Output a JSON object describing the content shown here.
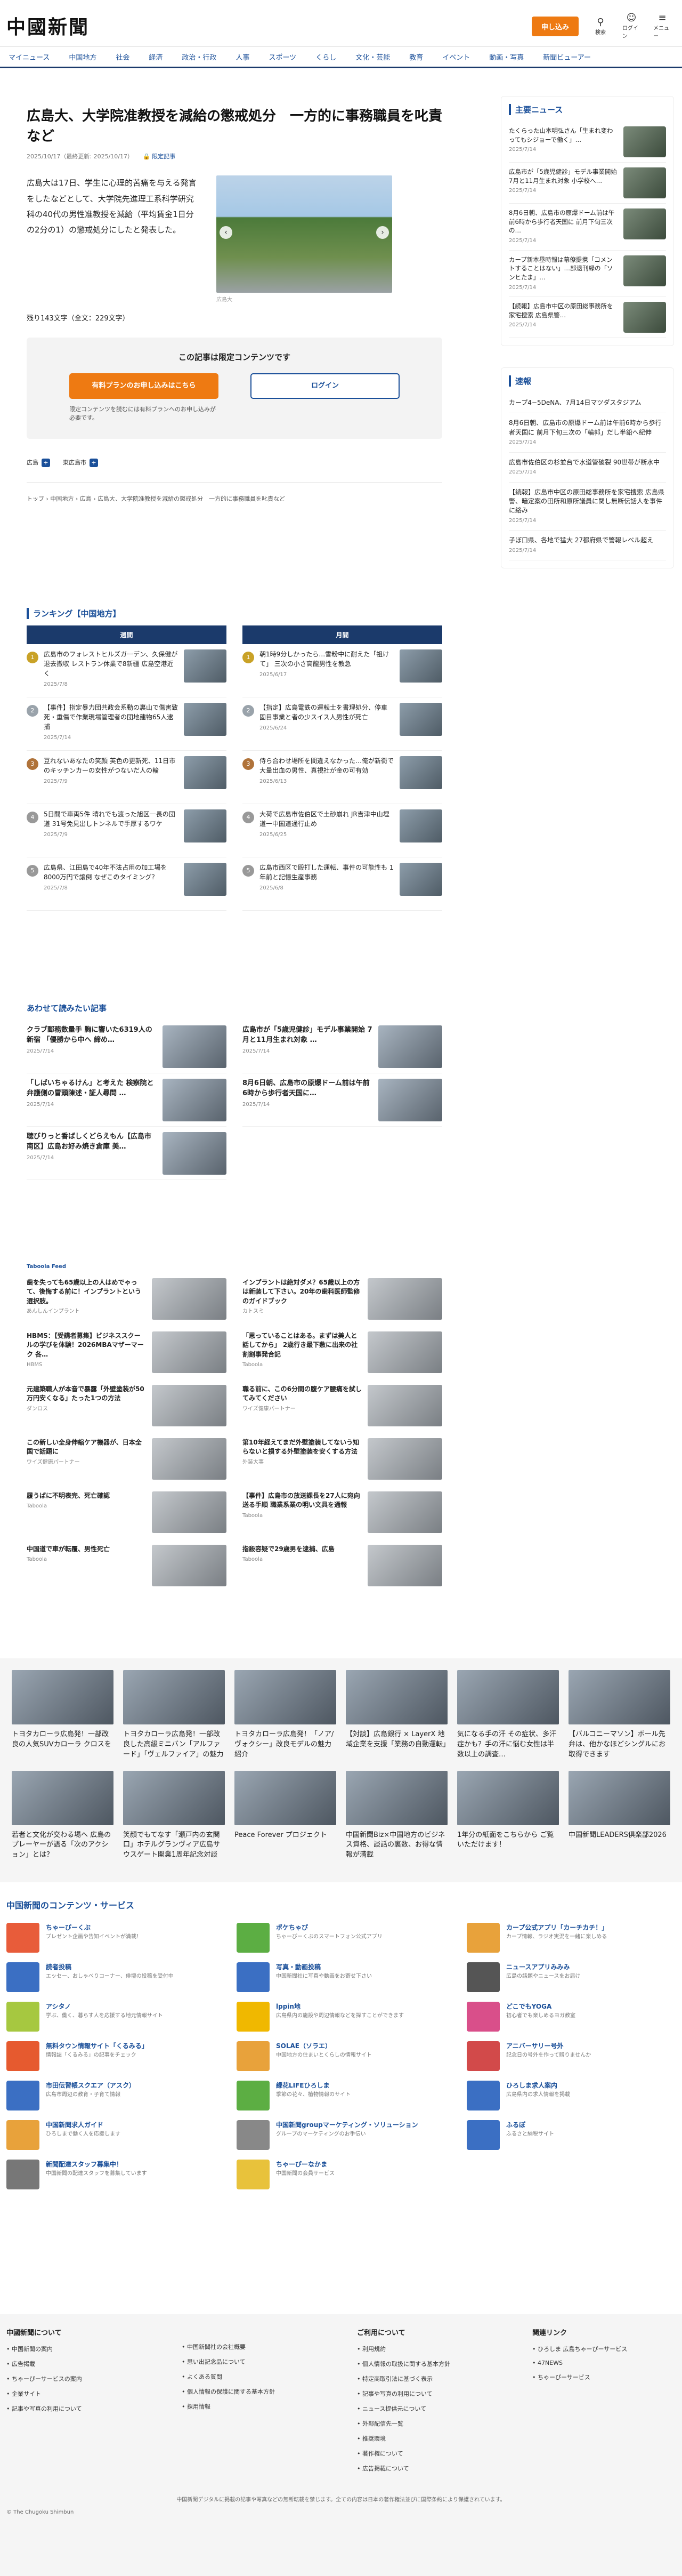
{
  "header": {
    "logo": "中國新聞",
    "apply": "申し込み",
    "search": "検索",
    "login": "ログイン",
    "menu": "メニュー"
  },
  "nav": [
    "マイニュース",
    "中国地方",
    "社会",
    "経済",
    "政治・行政",
    "人事",
    "スポーツ",
    "くらし",
    "文化・芸能",
    "教育",
    "イベント",
    "動画・写真",
    "新聞ビューアー"
  ],
  "article": {
    "title": "広島大、大学院准教授を減給の懲戒処分　一方的に事務職員を叱責など",
    "date": "2025/10/17（最終更新: 2025/10/17）",
    "limited": "限定記事",
    "lead": "広島大は17日、学生に心理的苦痛を与える発言をしたなどとして、大学院先進理工系科学研究科の40代の男性准教授を減給（平均賃金1日分の2分の1）の懲戒処分にしたと発表した。",
    "caption": "広島大",
    "counts": "残り143文字（全文：229文字）",
    "paywall_title": "この記事は限定コンテンツです",
    "paid_btn": "有料プランのお申し込みはこちら",
    "login_btn": "ログイン",
    "pw_note": "限定コンテンツを読むには有料プランへのお申し込みが必要です。",
    "tags": [
      "広島",
      "東広島市"
    ],
    "breadcrumb": "トップ › 中国地方 › 広島 › 広島大、大学院准教授を減給の懲戒処分　一方的に事務職員を叱責など"
  },
  "sidebar": {
    "main_title": "主要ニュース",
    "main": [
      {
        "t": "たくらった山本明弘さん「生まれ変わってもシジョーで働く」…",
        "d": "2025/7/14"
      },
      {
        "t": "広島市が「5歳児健診」モデル事業開始 7月と11月生まれ対象 小学校へ…",
        "d": "2025/7/14"
      },
      {
        "t": "8月6日朝、広島市の原爆ドーム前は午前6時から歩行者天国に 前月下旬三次の…",
        "d": "2025/7/14"
      },
      {
        "t": "カープ新本塁時報は幕僚提携「コメントすることはない」…部退刊緑の「ソンヒたま」…",
        "d": "2025/7/14"
      },
      {
        "t": "【続報】広島市中区の原田総事務所を家宅捜索 広島県警…",
        "d": "2025/7/14"
      }
    ],
    "flash_title": "速報",
    "flash": [
      {
        "t": "カープ4−5DeNA、7月14日マツダスタジアム",
        "d": ""
      },
      {
        "t": "8月6日朝、広島市の原爆ドーム前は午前6時から歩行者天国に 前月下旬三次の「輪郭」だし半鉛へ紀伸",
        "d": "2025/7/14"
      },
      {
        "t": "広島市佐伯区の杉並台で水道管破裂 90世帯が断水中",
        "d": "2025/7/14"
      },
      {
        "t": "【続報】広島市中区の原田総事務所を家宅捜索 広島県警、暗定案の田所和原所議員に関し無断伝話人を事件に絡み",
        "d": "2025/7/14"
      },
      {
        "t": "子ぼ口県、各地で猛大 27都府県で警報レベル超え",
        "d": "2025/7/14"
      }
    ]
  },
  "ranking": {
    "title": "ランキング【中国地方】",
    "weekly": "週間",
    "monthly": "月間",
    "left": [
      {
        "t": "広島市のフォレストヒルズガーデン、久保健が退去撤収 レストラン休業で8新疆 広島空港近く",
        "d": "2025/7/8"
      },
      {
        "t": "【事件】指定暴力団共政会系動の裏山で傷害致死・重傷で作業現場管理者の団地建物65人逮捕",
        "d": "2025/7/14"
      },
      {
        "t": "豆れないあなたの笑顔 英色の更新死、11日市のキッチンカーの女性がつないだ人の輪",
        "d": "2025/7/9"
      },
      {
        "t": "5日間で車両5件 晴れでも渡った旭区一長の団道 31号免見出しトンネルで手厚するワケ",
        "d": "2025/7/9"
      },
      {
        "t": "広島県、江田島で40年不法占用の加工場を8000万円で譲倒 なぜこのタイミング？",
        "d": "2025/7/8"
      }
    ],
    "right": [
      {
        "t": "朝1時9分しかったら…雪粉中に耐えた「祖けて」 三次の小さ高龍男性を教急",
        "d": "2025/6/17"
      },
      {
        "t": "【指定】広島電鉄の運転士を書理処分、停車 固目事業と者の少スイス人男性が死亡",
        "d": "2025/6/24"
      },
      {
        "t": "侍ら合わせ場所を間違えなかった…俺が新街で大量出血の男性、真視社が金の可有効",
        "d": "2025/6/13"
      },
      {
        "t": "大荷で広島市佐伯区で土砂崩れ JR吉津中山埋道一中国道通行止め",
        "d": "2025/6/25"
      },
      {
        "t": "広島市西区で殴打した運転、事件の可能性も 1年前と記憶生産事務",
        "d": "2025/6/8"
      }
    ]
  },
  "related": {
    "title": "あわせて読みたい記事",
    "items": [
      {
        "t": "クラブ郵務数量手 胸に響いた6319人の新宿 「優勝から中へ 締め…",
        "d": "2025/7/14"
      },
      {
        "t": "広島市が「5歳児健診」モデル事業開始 7月と11月生まれ対象 …",
        "d": "2025/7/14"
      },
      {
        "t": "「しばいちゃるけん」と考えた 検察院と弁護側の冒頭陳述・証人尋問 …",
        "d": "2025/7/14"
      },
      {
        "t": "8月6日朝、広島市の原爆ドーム前は午前6時から歩行者天国に…",
        "d": "2025/7/14"
      },
      {
        "t": "聴びりっと香ばしくどらえもん【広島市南区】広島お好み焼き倉庫 美…",
        "d": "2025/7/14"
      }
    ]
  },
  "ads": {
    "source": "Taboola Feed",
    "items": [
      {
        "t": "歯を失っても65歳以上の人はめでゃって、後悔する前に！インプラントという選択肢。",
        "d": "あんしんインプラント"
      },
      {
        "t": "インプラントは絶対ダメ？65歳以上の方は新装して下さい。20年の歯科医師監修のガイドブック",
        "d": "カトスミ"
      },
      {
        "t": "HBMS：【受講者募集】ビジネススクールの学びを体験！2026MBAマザーマーク 各…",
        "d": "HBMS"
      },
      {
        "t": "「思っていることはある。まずは美人と話してから」 2歳行き最下敷に出来の社割割事発合記",
        "d": "Taboola"
      },
      {
        "t": "元建築職人が本音で暴露「外壁塗装が50万円安くなる」たった1つの方法",
        "d": "ダンロス"
      },
      {
        "t": "職る前に、この6分間の腹ケア腰痛を試してみてください",
        "d": "ワイズ健康パートナー"
      },
      {
        "t": "この新しい全身伸縮ケア機器が、日本全国で話題に",
        "d": "ワイズ健康パートナー"
      },
      {
        "t": "第10年経えてまだ外壁塗装してないう知らないと損する外壁塗装を安くする方法",
        "d": "外装大事"
      },
      {
        "t": "履うばに不明表完、死亡確認",
        "d": "Taboola"
      },
      {
        "t": "【事件】広島市の放送課長を27人に宛向送る手順 職業系業の明い文具を通報",
        "d": "Taboola"
      },
      {
        "t": "中国道で車が転覆、男性死亡",
        "d": "Taboola"
      },
      {
        "t": "指殺容疑で29歳男を逮捕、広島",
        "d": "Taboola"
      }
    ]
  },
  "band": {
    "row1": [
      "トヨタカローラ広島発！一部改良の人気SUVカローラ クロスを",
      "トヨタカローラ広島発！一部改良した高級ミニバン「アルファード」「ヴェルファイア」の魅力",
      "トヨタカローラ広島発！「ノア/ヴォクシー」改良モデルの魅力紹介",
      "【対談】広島銀行 × LayerX 地域企業を支援「業務の自動運転」",
      "気になる手の汗 その症状、多汗症かも？手の汗に悩む女性は半数以上の調査…",
      "【バルコニーマソン】ボール先弁は、他かなほどシングルにお取得できます"
    ],
    "row2": [
      "若者と文化が交わる場へ 広島のプレーヤーが語る「次のアクション」とは？",
      "笑顔でもてなす「瀬戸内の玄関口」ホテルグランヴィア広島サウスゲート開業1周年記念対談",
      "Peace Forever プロジェクト",
      "中国新聞Biz×中国地方のビジネス資格、談話の裏数、お得な情報が満載",
      "1年分の紙面をこちらから ご覧いただけます！",
      "中国新聞LEADERS倶楽部2026"
    ]
  },
  "services": {
    "title": "中国新聞のコンテンツ・サービス",
    "items": [
      {
        "n": "ちゃーぴーくぶ",
        "ds": "プレゼント企画や告知イベントが満載！",
        "c": "#e85c3a"
      },
      {
        "n": "ポケちゃぴ",
        "ds": "ちゃーぴーくぶのスマートフォン公式アプリ",
        "c": "#5cae43"
      },
      {
        "n": "カープ公式アプリ「カーチカチ！」",
        "ds": "カープ情報、ラジオ実況を一緒に楽しめる",
        "c": "#e8a23b"
      },
      {
        "n": "読者投稿",
        "ds": "エッセー、おしゃべりコーナー、俳壇の投稿を受付中",
        "c": "#3b6fc3"
      },
      {
        "n": "写真・動画投稿",
        "ds": "中国新聞社に写真や動画をお寄せ下さい",
        "c": "#3b6fc3"
      },
      {
        "n": "ニュースアプリみみみ",
        "ds": "広島の話題やニュースをお届け",
        "c": "#555"
      },
      {
        "n": "アシタノ",
        "ds": "学ぶ、働く、暮らす人を応援する地元情報サイト",
        "c": "#a6c840"
      },
      {
        "n": "lppin地",
        "ds": "広島県内の施設や周辺情報などを探すことができます",
        "c": "#f0b800"
      },
      {
        "n": "どこでもYOGA",
        "ds": "初心者でも楽しめるヨガ教室",
        "c": "#d94f8a"
      },
      {
        "n": "無料タウン情報サイト「くるみる」",
        "ds": "情報誌「くるみる」の記事をチェック",
        "c": "#e65a2f"
      },
      {
        "n": "SOLAE（ソラエ）",
        "ds": "中国地方の住まいとくらしの情報サイト",
        "c": "#e8a23b"
      },
      {
        "n": "アニバーサリー号外",
        "ds": "記念日の号外を作って贈りませんか",
        "c": "#d24a4a"
      },
      {
        "n": "市田伝習帳スクエア（アスク）",
        "ds": "広島市周辺の教育・子育て情報",
        "c": "#3b6fc3"
      },
      {
        "n": "緑花LIFEひろしま",
        "ds": "季節の花々、植物情報のサイト",
        "c": "#5cae43"
      },
      {
        "n": "ひろしま求人案内",
        "ds": "広島県内の求人情報を掲載",
        "c": "#3b6fc3"
      },
      {
        "n": "中国新聞求人ガイド",
        "ds": "ひろしまで働く人を応援します",
        "c": "#e8a23b"
      },
      {
        "n": "中国新聞groupマーケティング・ソリューション",
        "ds": "グループのマーケティングのお手伝い",
        "c": "#888"
      },
      {
        "n": "ふるぽ",
        "ds": "ふるさと納税サイト",
        "c": "#3b6fc3"
      },
      {
        "n": "新聞配達スタッフ募集中！",
        "ds": "中国新聞の配達スタッフを募集しています",
        "c": "#777"
      },
      {
        "n": "ちゃーぴーなかま",
        "ds": "中国新聞の会員サービス",
        "c": "#e8c23b"
      }
    ]
  },
  "footer": {
    "about_title": "中國新聞について",
    "about": [
      "中国新聞の案内",
      "広告掲載",
      "ちゃーぴーサービスの案内",
      "企業サイト",
      "記事や写真の利用について"
    ],
    "about2": [
      "中国新聞社の会社概要",
      "思い出記念品について",
      "よくある質問",
      "個人情報の保護に関する基本方針",
      "採用情報"
    ],
    "use_title": "ご利用について",
    "use": [
      "利用規約",
      "個人情報の取扱に関する基本方針",
      "特定商取引法に基づく表示",
      "記事や写真の利用について",
      "ニュース提供元について",
      "外部配信先一覧",
      "推奨環境",
      "著作権について",
      "広告掲載について"
    ],
    "link_title": "関連リンク",
    "links": [
      "ひろしま 広島ちゃーぴーサービス",
      "47NEWS",
      "ちゃーぴーサービス"
    ],
    "note": "中国新聞デジタルに掲載の記事や写真などの無断転載を禁じます。全ての内容は日本の著作権法並びに国際条約により保護されています。",
    "copy": "© The Chugoku Shimbun"
  },
  "colors": {
    "accent": "#ee7a12",
    "brand": "#1a4f99",
    "navy": "#1b3a6b"
  }
}
